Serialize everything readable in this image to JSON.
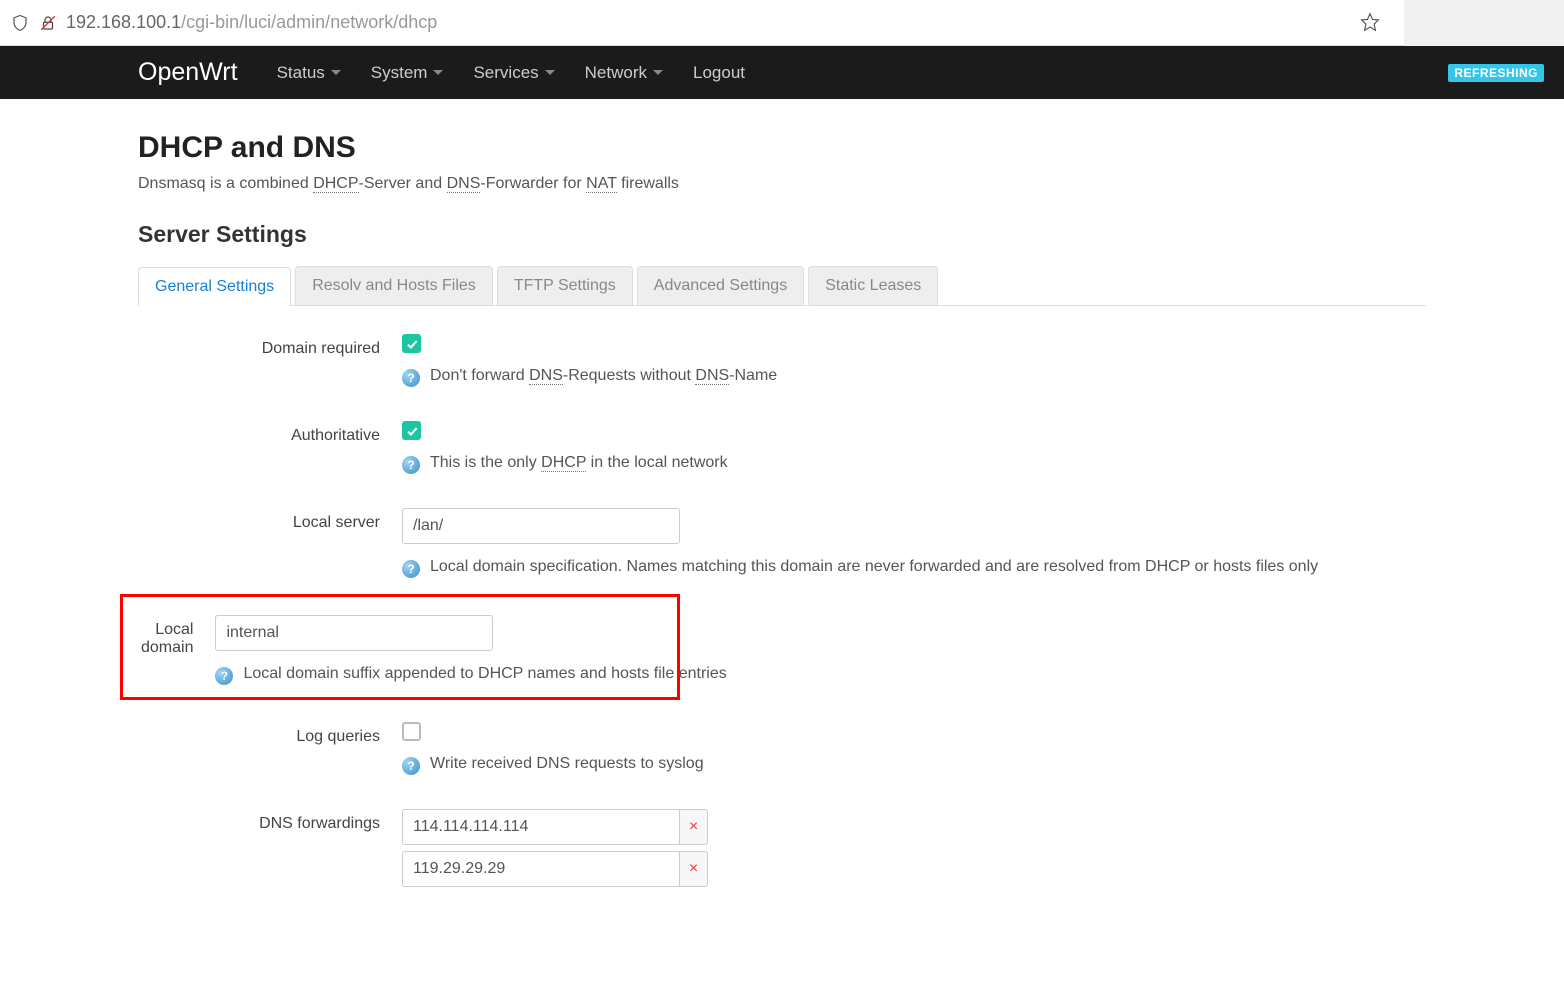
{
  "browser": {
    "url_host": "192.168.100.1",
    "url_path": "/cgi-bin/luci/admin/network/dhcp"
  },
  "navbar": {
    "brand": "OpenWrt",
    "items": [
      {
        "label": "Status",
        "dropdown": true
      },
      {
        "label": "System",
        "dropdown": true
      },
      {
        "label": "Services",
        "dropdown": true
      },
      {
        "label": "Network",
        "dropdown": true
      },
      {
        "label": "Logout",
        "dropdown": false
      }
    ],
    "refreshing_badge": "REFRESHING"
  },
  "page": {
    "title": "DHCP and DNS",
    "subtitle_parts": [
      "Dnsmasq is a combined ",
      "DHCP",
      "-Server and ",
      "DNS",
      "-Forwarder for ",
      "NAT",
      " firewalls"
    ],
    "section_heading": "Server Settings"
  },
  "tabs": [
    {
      "label": "General Settings",
      "active": true
    },
    {
      "label": "Resolv and Hosts Files",
      "active": false
    },
    {
      "label": "TFTP Settings",
      "active": false
    },
    {
      "label": "Advanced Settings",
      "active": false
    },
    {
      "label": "Static Leases",
      "active": false
    }
  ],
  "fields": {
    "domain_required": {
      "label": "Domain required",
      "checked": true,
      "hint_parts": [
        "Don't forward ",
        "DNS",
        "-Requests without ",
        "DNS",
        "-Name"
      ]
    },
    "authoritative": {
      "label": "Authoritative",
      "checked": true,
      "hint_parts": [
        "This is the only ",
        "DHCP",
        " in the local network"
      ]
    },
    "local_server": {
      "label": "Local server",
      "value": "/lan/",
      "hint": "Local domain specification. Names matching this domain are never forwarded and are resolved from DHCP or hosts files only"
    },
    "local_domain": {
      "label": "Local domain",
      "value": "internal",
      "hint": "Local domain suffix appended to DHCP names and hosts file entries"
    },
    "log_queries": {
      "label": "Log queries",
      "checked": false,
      "hint": "Write received DNS requests to syslog"
    },
    "dns_forwardings": {
      "label": "DNS forwardings",
      "values": [
        "114.114.114.114",
        "119.29.29.29"
      ]
    }
  }
}
